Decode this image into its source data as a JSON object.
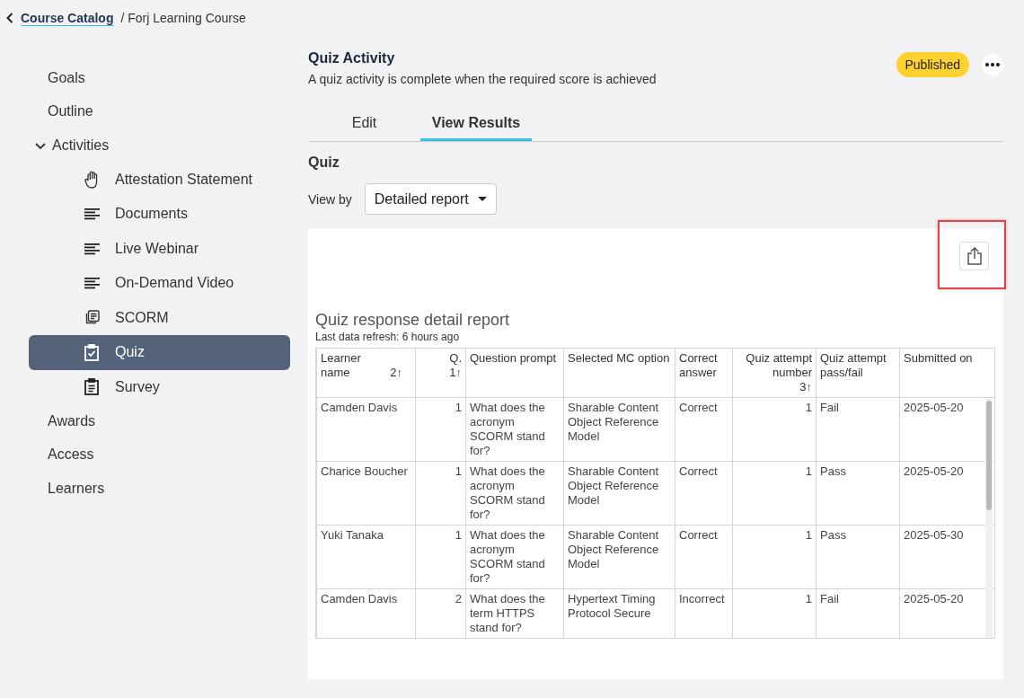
{
  "breadcrumb": {
    "link": "Course Catalog",
    "current": "/ Forj Learning Course"
  },
  "sidebar": {
    "items": [
      {
        "label": "Goals",
        "selected": false
      },
      {
        "label": "Outline",
        "selected": false
      },
      {
        "label": "Activities",
        "selected": false,
        "expanded": true,
        "children": [
          {
            "label": "Attestation Statement",
            "kind": "hand",
            "selected": false
          },
          {
            "label": "Documents",
            "kind": "lines",
            "selected": false
          },
          {
            "label": "Live Webinar",
            "kind": "lines",
            "selected": false
          },
          {
            "label": "On-Demand Video",
            "kind": "lines",
            "selected": false
          },
          {
            "label": "SCORM",
            "kind": "stack",
            "selected": false
          },
          {
            "label": "Quiz",
            "kind": "checklist",
            "selected": true
          },
          {
            "label": "Survey",
            "kind": "clipboard",
            "selected": false
          }
        ]
      },
      {
        "label": "Awards",
        "selected": false
      },
      {
        "label": "Access",
        "selected": false
      },
      {
        "label": "Learners",
        "selected": false
      }
    ]
  },
  "header": {
    "title": "Quiz Activity",
    "description": "A quiz activity is complete when the required score is achieved",
    "status": "Published"
  },
  "tabs": [
    {
      "label": "Edit",
      "selected": false
    },
    {
      "label": "View Results",
      "selected": true
    }
  ],
  "section_title": "Quiz",
  "view_by": {
    "label": "View by",
    "value": "Detailed report"
  },
  "report": {
    "title": "Quiz response detail report",
    "subtitle": "Last data refresh: 6 hours ago",
    "columns": [
      {
        "label": "Learner name",
        "sort": "2↑",
        "kind": "text"
      },
      {
        "label": "Q.",
        "sort": "1↑",
        "kind": "number"
      },
      {
        "label": "Question prompt",
        "kind": "text"
      },
      {
        "label": "Selected MC option",
        "kind": "text"
      },
      {
        "label": "Correct answer",
        "kind": "text"
      },
      {
        "label": "Quiz attempt number",
        "sort": "3↑",
        "kind": "number"
      },
      {
        "label": "Quiz attempt pass/fail",
        "kind": "text"
      },
      {
        "label": "Submitted on",
        "kind": "text"
      }
    ],
    "rows": [
      [
        "Camden Davis",
        "1",
        "What does the acronym SCORM stand for?",
        "Sharable Content Object Reference Model",
        "Correct",
        "1",
        "Fail",
        "2025-05-20"
      ],
      [
        "Charice Boucher",
        "1",
        "What does the acronym SCORM stand for?",
        "Sharable Content Object Reference Model",
        "Correct",
        "1",
        "Pass",
        "2025-05-20"
      ],
      [
        "Yuki Tanaka",
        "1",
        "What does the acronym SCORM stand for?",
        "Sharable Content Object Reference Model",
        "Correct",
        "1",
        "Pass",
        "2025-05-30"
      ],
      [
        "Camden Davis",
        "2",
        "What does the term HTTPS stand for?",
        "Hypertext Timing Protocol Secure",
        "Incorrect",
        "1",
        "Fail",
        "2025-05-20"
      ]
    ]
  }
}
